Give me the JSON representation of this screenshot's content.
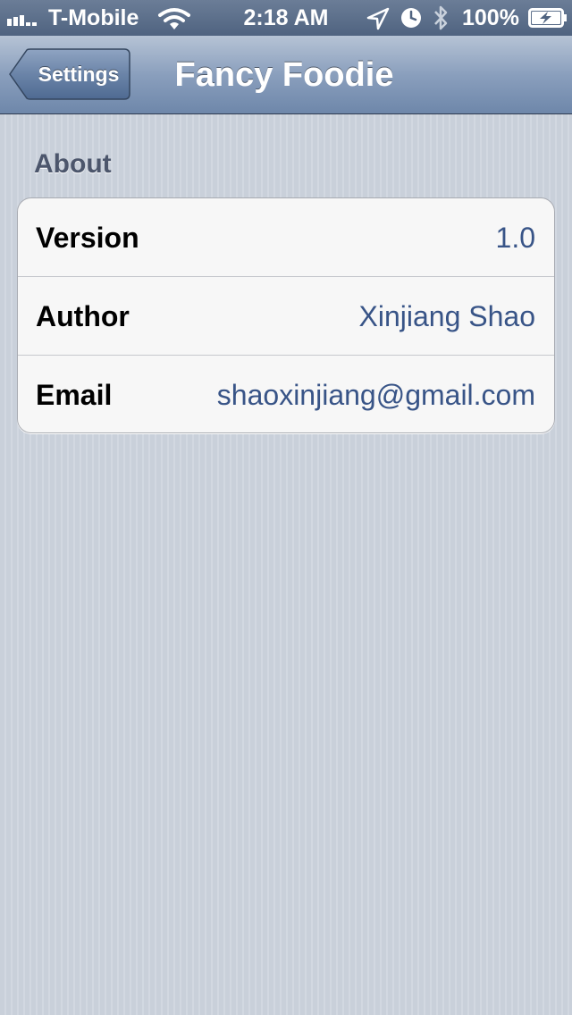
{
  "status_bar": {
    "carrier": "T-Mobile",
    "time": "2:18 AM",
    "battery_percent": "100%",
    "icons": [
      "signal-icon",
      "wifi-icon",
      "location-arrow-icon",
      "alarm-icon",
      "bluetooth-icon",
      "battery-charging-icon"
    ]
  },
  "nav_bar": {
    "back_label": "Settings",
    "title": "Fancy Foodie"
  },
  "section": {
    "header": "About",
    "rows": [
      {
        "label": "Version",
        "value": "1.0"
      },
      {
        "label": "Author",
        "value": "Xinjiang Shao"
      },
      {
        "label": "Email",
        "value": "shaoxinjiang@gmail.com"
      }
    ]
  },
  "colors": {
    "nav_tint": "#6e87aa",
    "value_text": "#385487",
    "section_header": "#4c566c",
    "background": "#cbd2dc"
  }
}
